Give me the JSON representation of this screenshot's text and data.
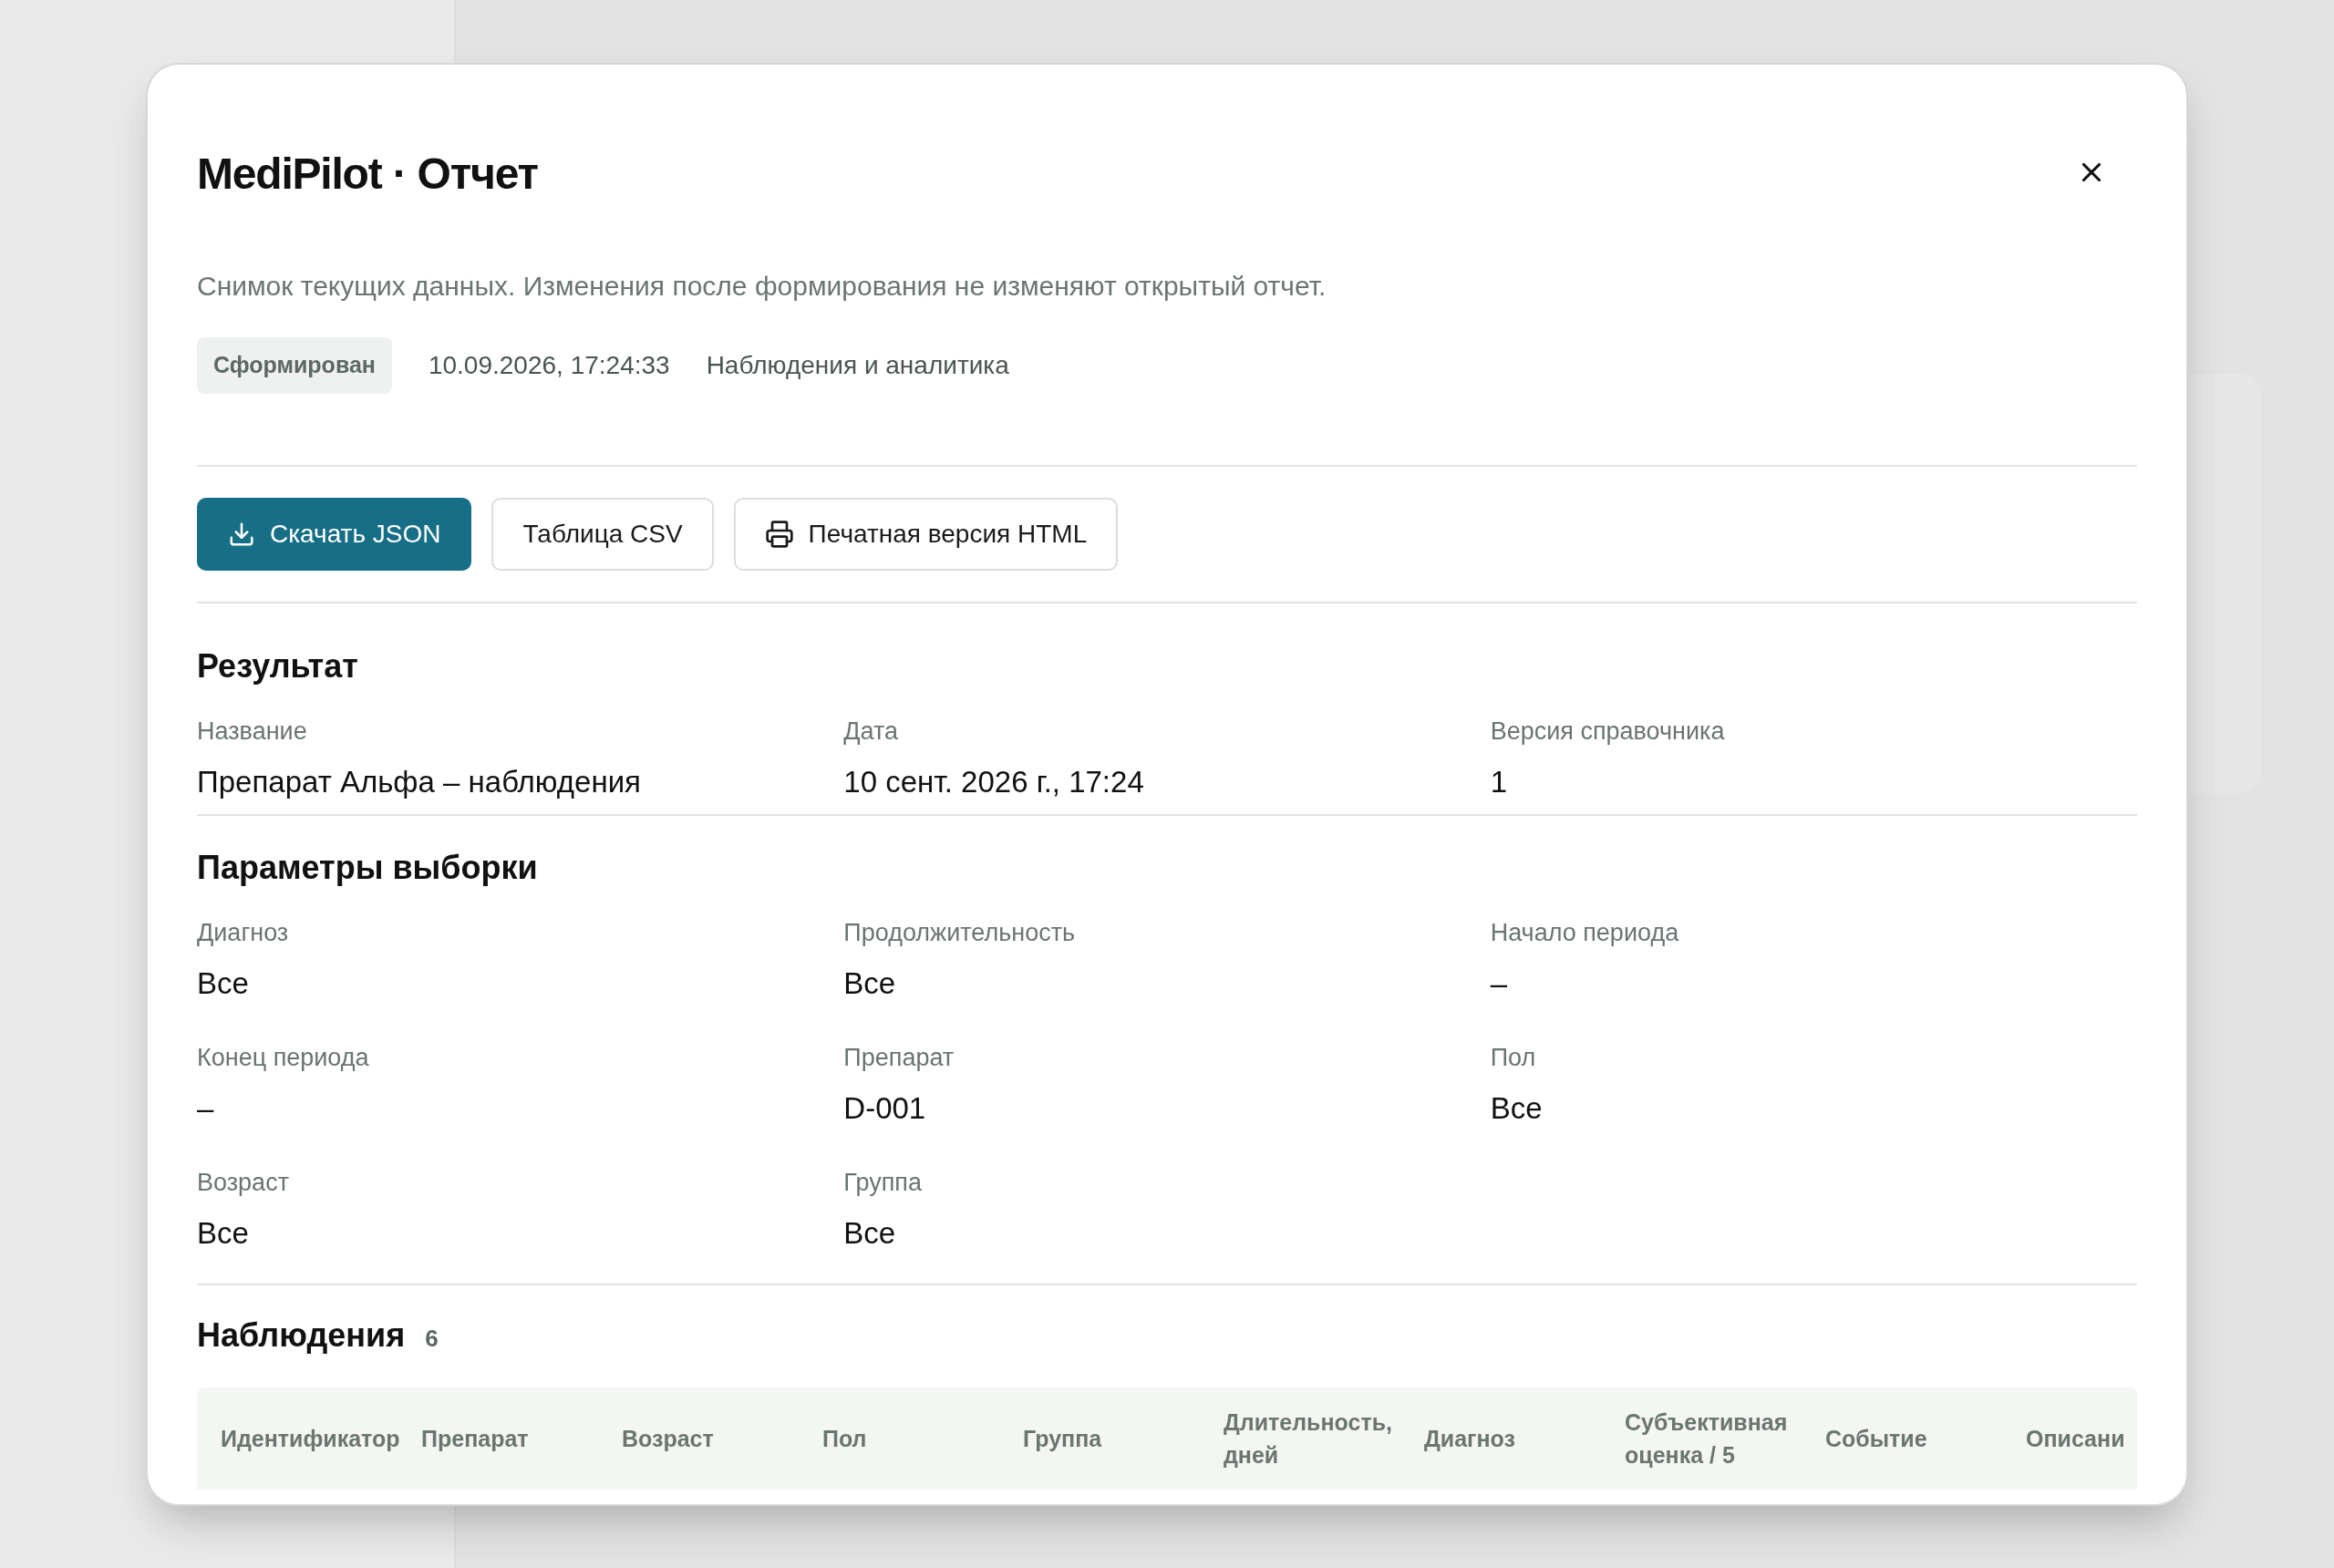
{
  "dialog": {
    "title": "MediPilot · Отчет",
    "description": "Снимок текущих данных. Изменения после формирования не изменяют открытый отчет.",
    "status": "Сформирован",
    "timestamp": "10.09.2026, 17:24:33",
    "category": "Наблюдения и аналитика",
    "actions": [
      {
        "label": "Скачать JSON",
        "kind": "download"
      },
      {
        "label": "Таблица CSV",
        "kind": "plain"
      },
      {
        "label": "Печатная версия HTML",
        "kind": "print"
      }
    ],
    "sections": [
      {
        "title": "Результат",
        "fields": [
          {
            "label": "Название",
            "value": "Препарат Альфа – наблюдения"
          },
          {
            "label": "Дата",
            "value": "10 сент. 2026 г., 17:24"
          },
          {
            "label": "Версия справочника",
            "value": "1"
          }
        ]
      },
      {
        "title": "Параметры выборки",
        "fields": [
          {
            "label": "Диагноз",
            "value": "Все"
          },
          {
            "label": "Продолжительность",
            "value": "Все"
          },
          {
            "label": "Начало периода",
            "value": "–"
          },
          {
            "label": "Конец периода",
            "value": "–"
          },
          {
            "label": "Препарат",
            "value": "D-001"
          },
          {
            "label": "Пол",
            "value": "Все"
          },
          {
            "label": "Возраст",
            "value": "Все"
          },
          {
            "label": "Группа",
            "value": "Все"
          }
        ]
      }
    ],
    "observations": {
      "title": "Наблюдения",
      "count": "6",
      "columns": [
        "Идентификатор",
        "Препарат",
        "Возраст",
        "Пол",
        "Группа",
        "Длительность, дней",
        "Диагноз",
        "Субъективная оценка / 5",
        "Событие",
        "Описани"
      ]
    }
  }
}
